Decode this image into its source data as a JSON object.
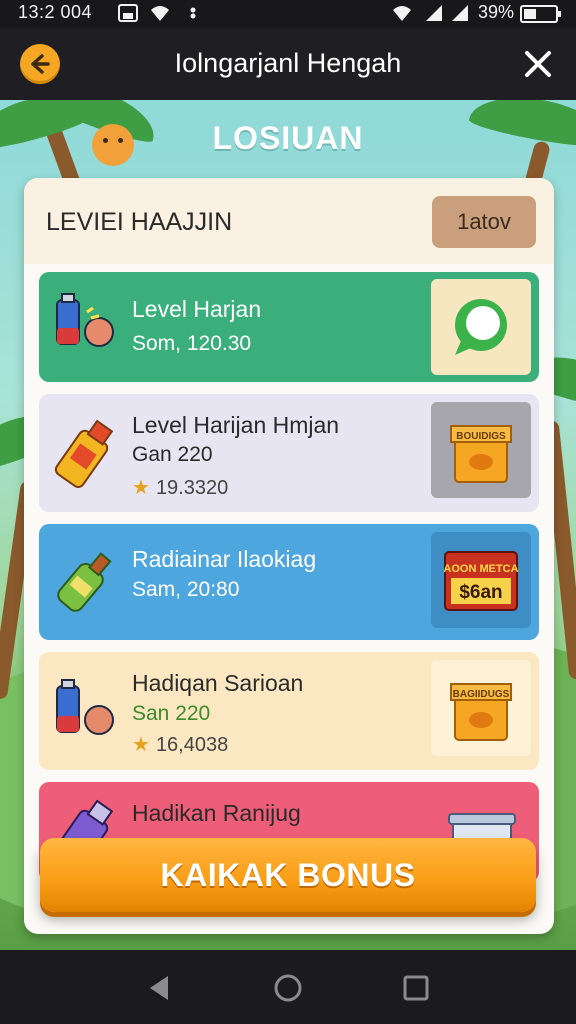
{
  "status_bar": {
    "time": "13:2 004",
    "battery_text": "39%",
    "icons": [
      "image-icon",
      "wifi-icon",
      "dot-icon",
      "wifi-icon",
      "signal-icon",
      "signal-icon",
      "battery-icon"
    ]
  },
  "header": {
    "title": "Iolngarjanl Hengah",
    "back_icon": "arrow-left-icon",
    "close_icon": "close-icon"
  },
  "scene": {
    "title": "LOSIUAN"
  },
  "panel": {
    "title": "LEVIEI HAAJJIN",
    "badge": "1atov"
  },
  "rewards": [
    {
      "name": "Level Harjan",
      "sub": "Som, 120.30",
      "rating": "",
      "icon": "battery-hand-icon",
      "thumb": "chat-bubble-icon",
      "color": "#3aaf7c"
    },
    {
      "name": "Level Harijan Hmjan",
      "sub": "Gan 220",
      "rating": "19.3320",
      "icon": "bottle-icon",
      "thumb": "bag-icon",
      "thumb_text": "BOUIDIGS",
      "color": "#e7e5f2"
    },
    {
      "name": "Radiainar Ilaokiag",
      "sub": "Sam, 20:80",
      "rating": "",
      "icon": "green-bottle-icon",
      "thumb": "sign-icon",
      "thumb_text_top": "AOON METCA",
      "thumb_text_bottom": "$6an",
      "color": "#4ea6df"
    },
    {
      "name": "Hadiqan Sarioan",
      "sub": "San 220",
      "rating": "16,4038",
      "icon": "battery-hand-icon",
      "thumb": "bag-icon",
      "thumb_text": "BAGIIDUGS",
      "color": "#fbe8c3"
    },
    {
      "name": "Hadikan Ranijug",
      "sub": "",
      "rating": "",
      "icon": "purple-bottle-icon",
      "thumb": "box-icon",
      "color": "#ee5e78"
    }
  ],
  "bonus_button": {
    "label": "KAIKAK BONUS"
  },
  "nav": {
    "back_icon": "triangle-back-icon",
    "home_icon": "circle-home-icon",
    "recents_icon": "square-recents-icon"
  }
}
